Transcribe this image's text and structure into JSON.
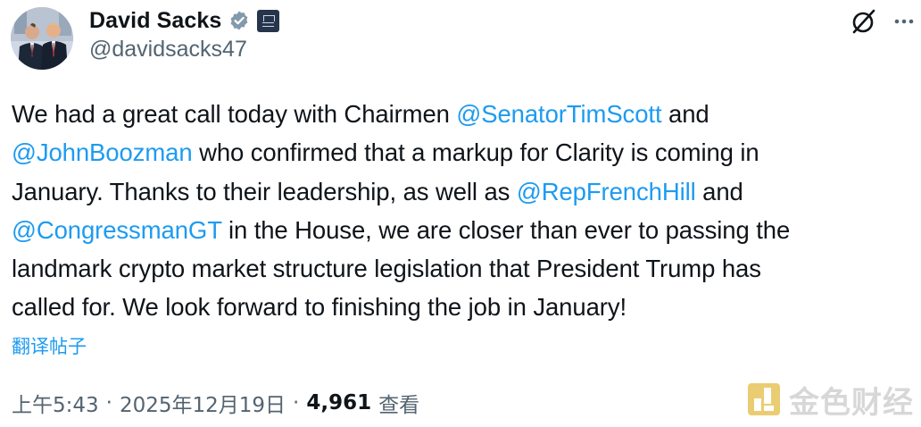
{
  "author": {
    "display_name": "David Sacks",
    "handle": "@davidsacks47",
    "verified_badge": "verified-icon",
    "affiliate_badge": "white-house-badge-icon",
    "avatar": "avatar-photo"
  },
  "actions": {
    "grok_icon": "grok-icon",
    "more_icon": "more-icon"
  },
  "tweet": {
    "lines": [
      [
        {
          "text": "We had a great call today with Chairmen ",
          "type": "text"
        },
        {
          "text": "@SenatorTimScott",
          "type": "mention"
        },
        {
          "text": " and",
          "type": "text"
        }
      ],
      [
        {
          "text": "@JohnBoozman",
          "type": "mention"
        },
        {
          "text": " who confirmed that a markup for Clarity is coming in",
          "type": "text"
        }
      ],
      [
        {
          "text": "January. Thanks to their leadership, as well as ",
          "type": "text"
        },
        {
          "text": "@RepFrenchHill",
          "type": "mention"
        },
        {
          "text": " and",
          "type": "text"
        }
      ],
      [
        {
          "text": "@CongressmanGT",
          "type": "mention"
        },
        {
          "text": " in the House, we are closer than ever to passing the",
          "type": "text"
        }
      ],
      [
        {
          "text": "landmark crypto market structure legislation that President Trump has",
          "type": "text"
        }
      ],
      [
        {
          "text": "called for. We look forward to finishing the job in January!",
          "type": "text"
        }
      ]
    ],
    "translate_label": "翻译帖子"
  },
  "meta": {
    "time": "上午5:43",
    "separator": "·",
    "date": "2025年12月19日",
    "views_count": "4,961",
    "views_label": "查看"
  },
  "watermark": {
    "text": "金色财经",
    "logo": "golden-finance-logo"
  },
  "colors": {
    "text": "#0f1419",
    "secondary": "#536471",
    "link": "#1d9bf0",
    "verified": "#829aab",
    "background": "#ffffff"
  }
}
